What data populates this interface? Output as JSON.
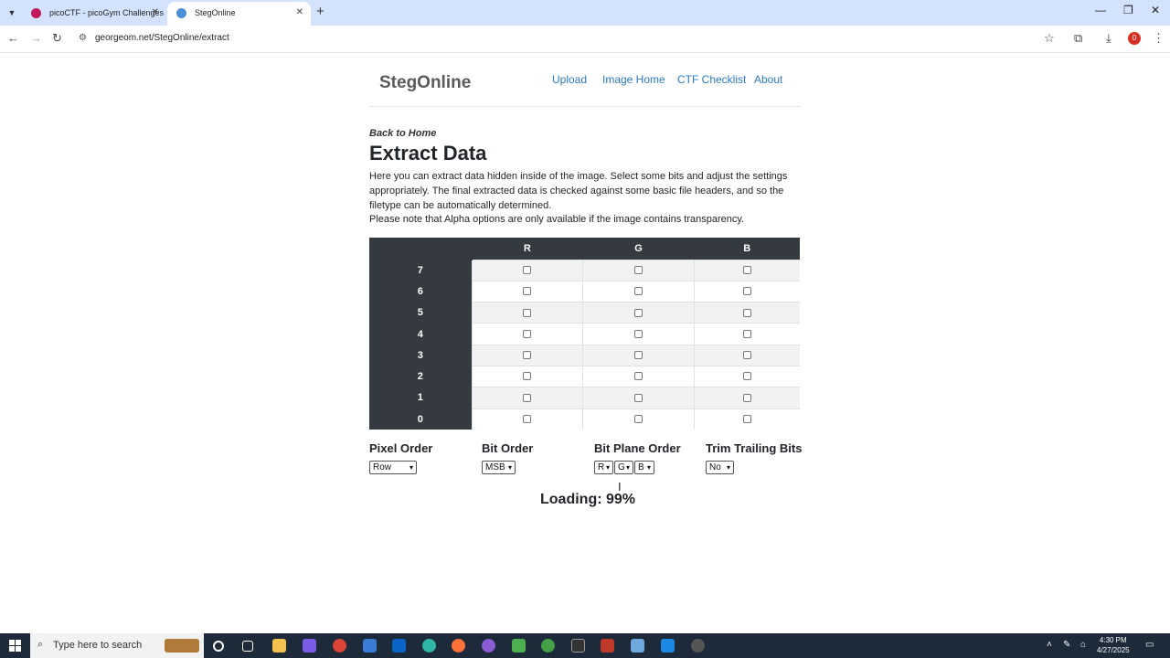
{
  "browser": {
    "tabs": [
      {
        "title": "picoCTF - picoGym Challenges",
        "favicon_color": "#c2185b"
      },
      {
        "title": "StegOnline",
        "favicon_color": "#4a90d9"
      }
    ],
    "url": "georgeom.net/StegOnline/extract",
    "profile_badge": "0"
  },
  "site": {
    "brand": "StegOnline",
    "nav": [
      "Upload",
      "Image Home",
      "CTF Checklist",
      "About"
    ]
  },
  "content": {
    "back_link": "Back to Home",
    "title": "Extract Data",
    "description": "Here you can extract data hidden inside of the image. Select some bits and adjust the settings appropriately. The final extracted data is checked against some basic file headers, and so the filetype can be automatically determined.",
    "note": "Please note that Alpha options are only available if the image contains transparency.",
    "table": {
      "columns": [
        "R",
        "G",
        "B"
      ],
      "rows": [
        "7",
        "6",
        "5",
        "4",
        "3",
        "2",
        "1",
        "0"
      ]
    },
    "options": {
      "pixel_order": {
        "label": "Pixel Order",
        "value": "Row"
      },
      "bit_order": {
        "label": "Bit Order",
        "value": "MSB"
      },
      "bit_plane_order": {
        "label": "Bit Plane Order",
        "values": [
          "R",
          "G",
          "B"
        ]
      },
      "trim_trailing": {
        "label": "Trim Trailing Bits",
        "value": "No"
      }
    },
    "loading": "Loading: 99%"
  },
  "taskbar": {
    "search_placeholder": "Type here to search",
    "time": "4:30 PM",
    "date": "4/27/2025"
  }
}
